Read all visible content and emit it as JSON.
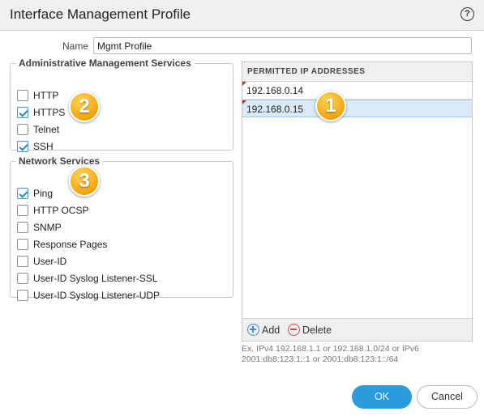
{
  "dialog": {
    "title": "Interface Management Profile",
    "help_icon": "question-circle-icon",
    "help_glyph": "?"
  },
  "name_field": {
    "label": "Name",
    "value": "Mgmt Profile"
  },
  "admin_services": {
    "legend": "Administrative Management Services",
    "items": [
      {
        "label": "HTTP",
        "checked": false
      },
      {
        "label": "HTTPS",
        "checked": true
      },
      {
        "label": "Telnet",
        "checked": false
      },
      {
        "label": "SSH",
        "checked": true
      }
    ]
  },
  "network_services": {
    "legend": "Network Services",
    "items": [
      {
        "label": "Ping",
        "checked": true
      },
      {
        "label": "HTTP OCSP",
        "checked": false
      },
      {
        "label": "SNMP",
        "checked": false
      },
      {
        "label": "Response Pages",
        "checked": false
      },
      {
        "label": "User-ID",
        "checked": false
      },
      {
        "label": "User-ID Syslog Listener-SSL",
        "checked": false
      },
      {
        "label": "User-ID Syslog Listener-UDP",
        "checked": false
      }
    ]
  },
  "permitted_ips": {
    "header": "PERMITTED IP ADDRESSES",
    "rows": [
      {
        "value": "192.168.0.14",
        "selected": false
      },
      {
        "value": "192.168.0.15",
        "selected": true
      }
    ],
    "add_label": "Add",
    "delete_label": "Delete",
    "hint": "Ex. IPv4 192.168.1.1 or 192.168.1.0/24 or IPv6 2001:db8:123:1::1 or 2001:db8:123:1::/64"
  },
  "footer": {
    "ok_label": "OK",
    "cancel_label": "Cancel"
  },
  "callouts": {
    "one": "1",
    "two": "2",
    "three": "3"
  },
  "colors": {
    "accent": "#2a9cdc",
    "checkmark": "#2b84c6",
    "selected_row": "#dbeaf7",
    "callout": "#f2a40e",
    "delete": "#d64545"
  }
}
